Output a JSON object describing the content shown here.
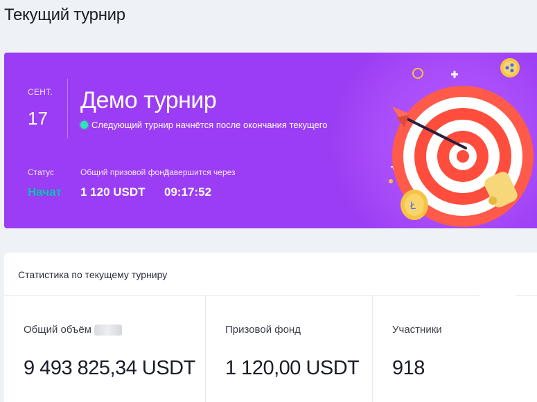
{
  "page": {
    "title": "Текущий турнир"
  },
  "banner": {
    "date_month": "СЕНТ.",
    "date_day": "17",
    "title": "Демо турнир",
    "subtitle": "Следующий турнир начнётся после окончания текущего",
    "status_label": "Статус",
    "status_value": "Начат",
    "prize_label": "Общий призовой фонд",
    "prize_value": "1 120 USDT",
    "ends_label": "Завершится через",
    "ends_value": "09:17:52",
    "colors": {
      "background": "#9b3df4",
      "status": "#1fb6c9",
      "indicator": "#2ee6b5"
    },
    "illustration": "target-with-arrow-and-coins"
  },
  "stats": {
    "header": "Статистика по текущему турниру",
    "columns": [
      {
        "label": "Общий объём",
        "value": "9 493 825,34 USDT"
      },
      {
        "label": "Призовой фонд",
        "value": "1 120,00 USDT"
      },
      {
        "label": "Участники",
        "value": "918"
      }
    ]
  }
}
